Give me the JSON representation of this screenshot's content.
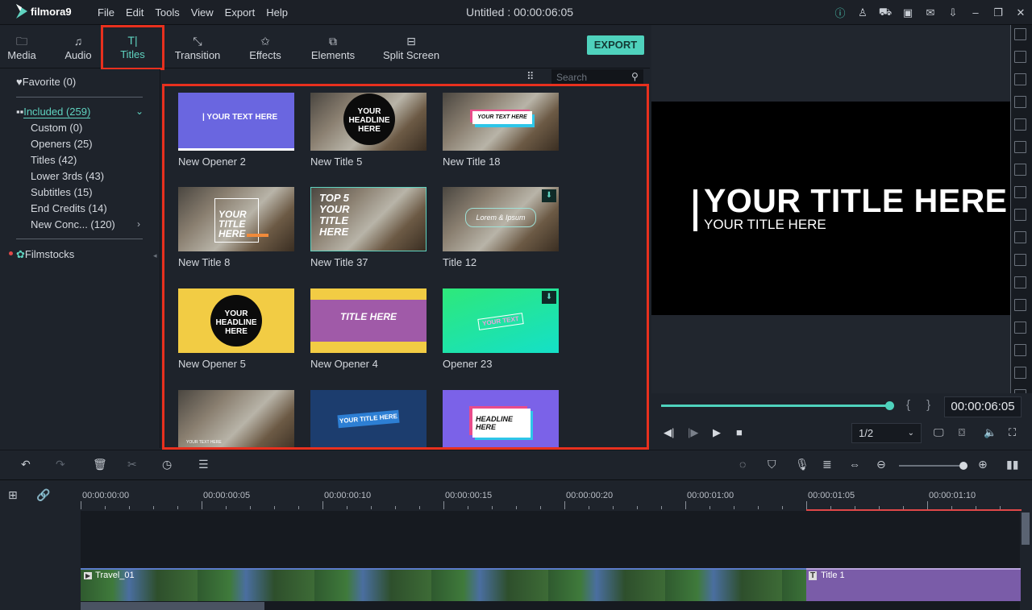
{
  "app": {
    "name": "filmora9",
    "window_title": "Untitled : 00:00:06:05",
    "menu": [
      "File",
      "Edit",
      "Tools",
      "View",
      "Export",
      "Help"
    ],
    "title_icons": [
      "info-icon",
      "account-icon",
      "cart-icon",
      "save-icon",
      "mail-icon",
      "download-icon",
      "minimize-icon",
      "restore-icon",
      "close-icon"
    ]
  },
  "tabs": [
    {
      "label": "Media",
      "icon": "folder-icon",
      "active": false
    },
    {
      "label": "Audio",
      "icon": "music-icon",
      "active": false
    },
    {
      "label": "Titles",
      "icon": "titles-icon",
      "active": true
    },
    {
      "label": "Transition",
      "icon": "transition-icon",
      "active": false
    },
    {
      "label": "Effects",
      "icon": "effects-icon",
      "active": false
    },
    {
      "label": "Elements",
      "icon": "elements-icon",
      "active": false
    },
    {
      "label": "Split Screen",
      "icon": "split-screen-icon",
      "active": false
    }
  ],
  "export_label": "EXPORT",
  "search": {
    "placeholder": "Search"
  },
  "sidebar": {
    "favorite": "Favorite (0)",
    "included": "Included (259)",
    "items": [
      "Custom (0)",
      "Openers (25)",
      "Titles (42)",
      "Lower 3rds (43)",
      "Subtitles (15)",
      "End Credits (14)",
      "New Conc... (120)"
    ],
    "filmstocks": "Filmstocks"
  },
  "titles": [
    {
      "name": "New Opener 2",
      "thumb_text": "| YOUR TEXT HERE",
      "download": false
    },
    {
      "name": "New Title 5",
      "thumb_text": "YOUR HEADLINE HERE",
      "download": false
    },
    {
      "name": "New Title 18",
      "thumb_text": "YOUR TEXT HERE",
      "download": false
    },
    {
      "name": "New Title 8",
      "thumb_text": "YOUR TITLE HERE",
      "download": false
    },
    {
      "name": "New Title 37",
      "thumb_text": "TOP 5 YOUR TITLE HERE",
      "download": false
    },
    {
      "name": "Title 12",
      "thumb_text": "Lorem & Ipsum",
      "download": true
    },
    {
      "name": "New Opener 5",
      "thumb_text": "YOUR HEADLINE HERE",
      "download": false
    },
    {
      "name": "New Opener 4",
      "thumb_text": "TITLE HERE",
      "download": false
    },
    {
      "name": "Opener 23",
      "thumb_text": "YOUR TEXT",
      "download": true
    },
    {
      "name": "",
      "thumb_text": "YOUR TEXT HERE",
      "download": false
    },
    {
      "name": "",
      "thumb_text": "YOUR TITLE HERE",
      "download": false
    },
    {
      "name": "",
      "thumb_text": "HEADLINE HERE",
      "download": false
    }
  ],
  "preview": {
    "title_main": "YOUR TITLE HERE",
    "title_sub": "YOUR TITLE HERE",
    "progress": 1.0,
    "timecode": "00:00:06:05",
    "braces": "{ }",
    "zoom_ratio": "1/2"
  },
  "timeline": {
    "ruler_labels": [
      "00:00:00:00",
      "00:00:00:05",
      "00:00:00:10",
      "00:00:00:15",
      "00:00:00:20",
      "00:00:01:00",
      "00:00:01:05",
      "00:00:01:10"
    ],
    "clips": [
      {
        "label": "Travel_01",
        "type": "video"
      },
      {
        "label": "Title 1",
        "type": "title"
      }
    ],
    "zoom_level": 1.0
  },
  "colors": {
    "accent": "#4fd2bd",
    "highlight": "#e8301e",
    "title_clip": "#7a5ca8"
  }
}
